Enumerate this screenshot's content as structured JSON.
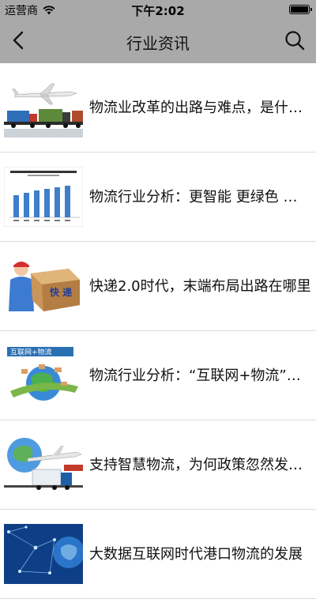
{
  "status_bar": {
    "carrier": "运营商",
    "time": "下午2:02"
  },
  "nav": {
    "title": "行业资讯"
  },
  "news": [
    {
      "title": "物流业改革的出路与难点，是什么？",
      "thumbnail": "airplane-trucks-icon"
    },
    {
      "title": "物流行业分析：更智能 更绿色 更高效",
      "thumbnail": "bar-chart-icon"
    },
    {
      "title": "快递2.0时代，末端布局出路在哪里",
      "thumbnail": "courier-box-icon",
      "thumb_text": "快 递"
    },
    {
      "title": "物流行业分析：“互联网+物流”模式",
      "thumbnail": "internet-logistics-globe-icon",
      "thumb_text": "互联网+物流"
    },
    {
      "title": "支持智慧物流，为何政策忽然发力？",
      "thumbnail": "globe-plane-truck-icon"
    },
    {
      "title": "大数据互联网时代港口物流的发展",
      "thumbnail": "network-globe-icon"
    }
  ]
}
